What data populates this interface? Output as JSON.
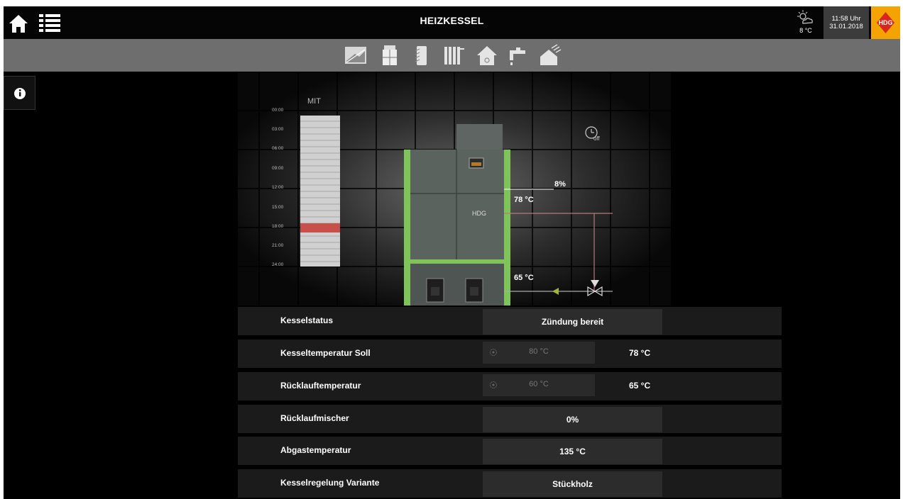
{
  "header": {
    "title": "HEIZKESSEL",
    "weather_temp": "8 °C",
    "time": "11:58 Uhr",
    "date": "31.01.2018",
    "logo_text": "HDG"
  },
  "nav_icons": [
    "boiler-feed-icon",
    "boiler-icon",
    "buffer-tank-icon",
    "radiator-icon",
    "house-icon",
    "tap-icon",
    "solar-house-icon"
  ],
  "schedule": {
    "label": "MIT",
    "times": [
      "00:00",
      "03:00",
      "06:00",
      "09:00",
      "12:00",
      "15:00",
      "18:00",
      "21:00",
      "24:00"
    ],
    "timer_state": "off"
  },
  "diagram": {
    "brand": "HDG",
    "percent": "8%",
    "flow_temp": "78 °C",
    "return_temp": "65 °C"
  },
  "table": {
    "rows": [
      {
        "name": "Kesselstatus",
        "value": "Zündung bereit"
      },
      {
        "name": "Kesseltemperatur Soll",
        "set": "80 °C",
        "actual": "78 °C"
      },
      {
        "name": "Rücklauftemperatur",
        "set": "60 °C",
        "actual": "65 °C"
      },
      {
        "name": "Rücklaufmischer",
        "value": "0%"
      },
      {
        "name": "Abgastemperatur",
        "value": "135 °C"
      },
      {
        "name": "Kesselregelung Variante",
        "value": "Stückholz"
      }
    ]
  },
  "colors": {
    "accent_orange": "#f5a300",
    "boiler_green": "#7fc45a",
    "schedule_red": "#c8504a"
  }
}
